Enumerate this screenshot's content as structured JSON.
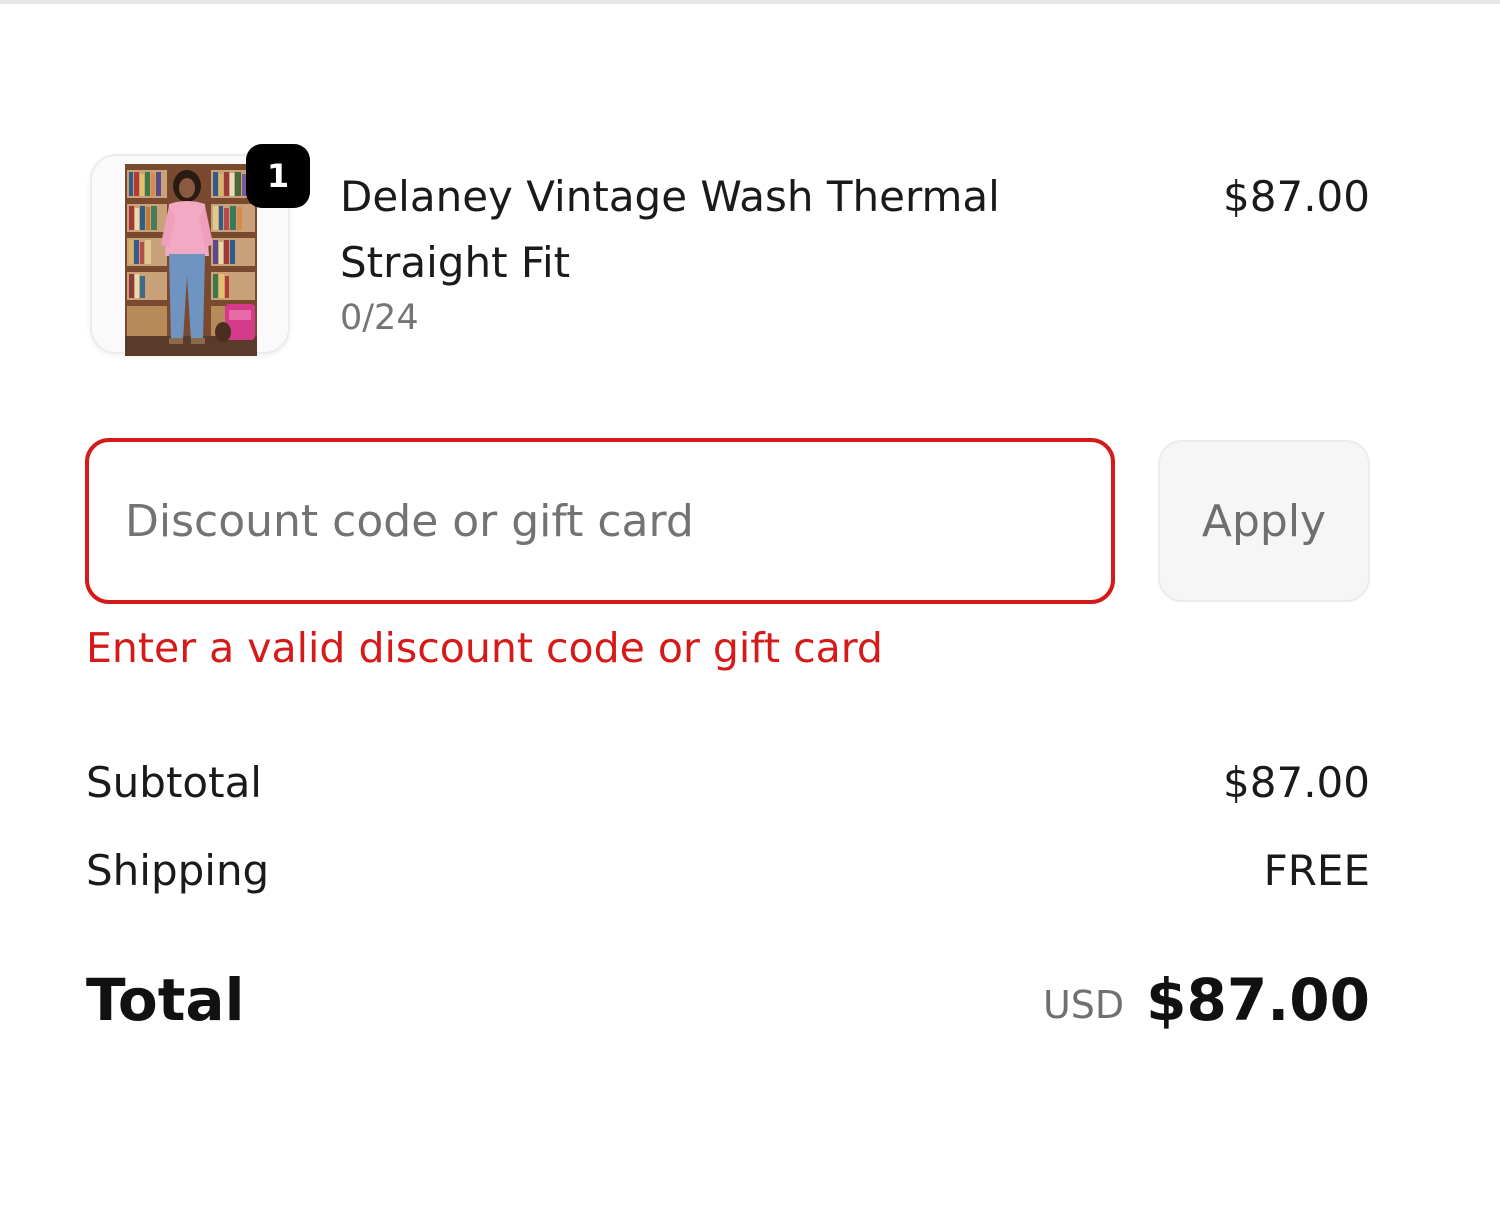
{
  "line_item": {
    "quantity": "1",
    "title": "Delaney Vintage Wash Thermal Straight Fit",
    "variant": "0/24",
    "price": "$87.00"
  },
  "discount": {
    "placeholder": "Discount code or gift card",
    "value": "",
    "apply_label": "Apply",
    "error": "Enter a valid discount code or gift card",
    "error_color": "#d61a1a"
  },
  "summary": {
    "subtotal_label": "Subtotal",
    "subtotal_value": "$87.00",
    "shipping_label": "Shipping",
    "shipping_value": "FREE",
    "total_label": "Total",
    "currency": "USD",
    "total_value": "$87.00"
  }
}
